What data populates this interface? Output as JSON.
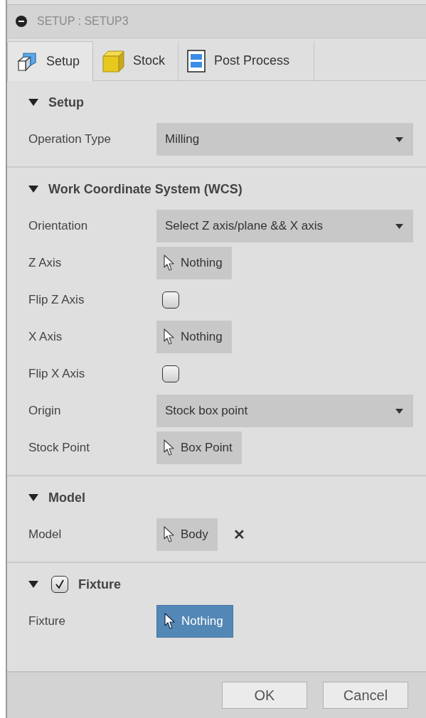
{
  "window": {
    "title": "SETUP : SETUP3"
  },
  "tabs": [
    {
      "label": "Setup",
      "selected": true
    },
    {
      "label": "Stock",
      "selected": false
    },
    {
      "label": "Post Process",
      "selected": false
    }
  ],
  "sections": [
    {
      "title": "Setup",
      "expanded": true,
      "rows": [
        {
          "label": "Operation Type",
          "kind": "dropdown",
          "value": "Milling"
        }
      ]
    },
    {
      "title": "Work Coordinate System (WCS)",
      "expanded": true,
      "rows": [
        {
          "label": "Orientation",
          "kind": "dropdown",
          "value": "Select Z axis/plane && X axis"
        },
        {
          "label": "Z Axis",
          "kind": "picker",
          "value": "Nothing",
          "active": false
        },
        {
          "label": "Flip Z Axis",
          "kind": "checkbox",
          "checked": false
        },
        {
          "label": "X Axis",
          "kind": "picker",
          "value": "Nothing",
          "active": false
        },
        {
          "label": "Flip X Axis",
          "kind": "checkbox",
          "checked": false
        },
        {
          "label": "Origin",
          "kind": "dropdown",
          "value": "Stock box point"
        },
        {
          "label": "Stock Point",
          "kind": "picker",
          "value": "Box Point",
          "active": false
        }
      ]
    },
    {
      "title": "Model",
      "expanded": true,
      "rows": [
        {
          "label": "Model",
          "kind": "picker",
          "value": "Body",
          "active": false,
          "clear": "✕"
        }
      ]
    },
    {
      "title": "Fixture",
      "expanded": true,
      "enabled": true,
      "rows": [
        {
          "label": "Fixture",
          "kind": "picker",
          "value": "Nothing",
          "active": true
        }
      ]
    }
  ],
  "buttons": [
    "OK",
    "Cancel"
  ]
}
